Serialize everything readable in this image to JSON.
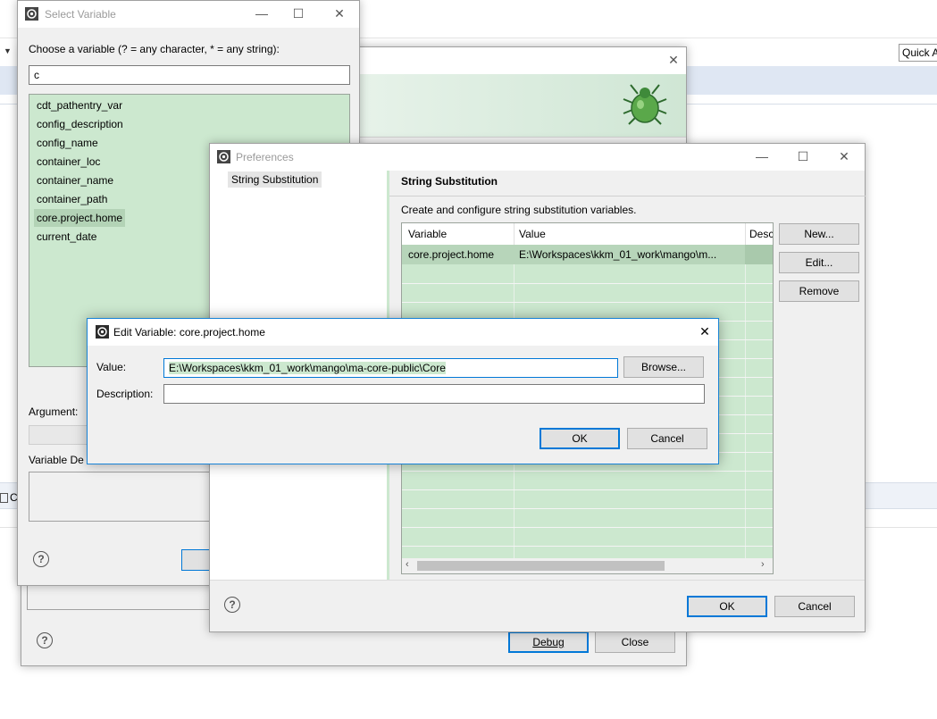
{
  "background": {
    "quick_access": "Quick A",
    "partial_label": "Co"
  },
  "launch_dialog": {
    "debug_label": "Debug",
    "close_label": "Close"
  },
  "select_variable": {
    "title": "Select Variable",
    "prompt": "Choose a variable (? = any character, * = any string):",
    "filter_value": "c",
    "variables": [
      "cdt_pathentry_var",
      "config_description",
      "config_name",
      "container_loc",
      "container_name",
      "container_path",
      "core.project.home",
      "current_date"
    ],
    "selected_variable": "core.project.home",
    "argument_label": "Argument:",
    "variable_desc_label": "Variable De"
  },
  "preferences": {
    "title": "Preferences",
    "nav_items": [
      "String Substitution"
    ],
    "page_title": "String Substitution",
    "page_description": "Create and configure string substitution variables.",
    "table": {
      "columns": [
        "Variable",
        "Value",
        "Desc"
      ],
      "rows": [
        {
          "variable": "core.project.home",
          "value": "E:\\Workspaces\\kkm_01_work\\mango\\m..."
        }
      ]
    },
    "new_label": "New...",
    "edit_label": "Edit...",
    "remove_label": "Remove",
    "ok_label": "OK",
    "cancel_label": "Cancel"
  },
  "edit_variable": {
    "title": "Edit Variable: core.project.home",
    "value_label": "Value:",
    "value": "E:\\Workspaces\\kkm_01_work\\mango\\ma-core-public\\Core",
    "browse_label": "Browse...",
    "description_label": "Description:",
    "description_value": "",
    "ok_label": "OK",
    "cancel_label": "Cancel"
  },
  "colors": {
    "selection_green": "#cce8cf",
    "accent_blue": "#0078d7",
    "dialog_bg": "#f0f0f0"
  }
}
